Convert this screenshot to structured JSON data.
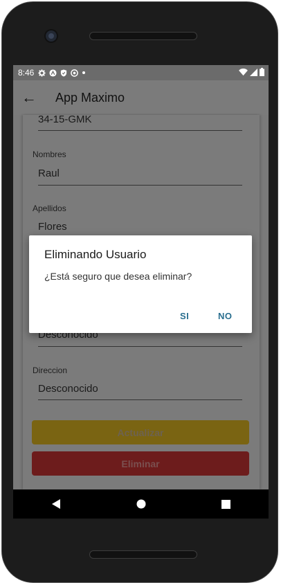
{
  "status_bar": {
    "time": "8:46"
  },
  "app_bar": {
    "back_glyph": "←",
    "title": "App Maximo"
  },
  "form": {
    "fields": [
      {
        "label": "",
        "value": "34-15-GMK"
      },
      {
        "label": "Nombres",
        "value": "Raul"
      },
      {
        "label": "Apellidos",
        "value": "Flores"
      },
      {
        "label": "",
        "value": "Desconocido"
      },
      {
        "label": "Direccion",
        "value": "Desconocido"
      }
    ],
    "update_label": "Actualizar",
    "delete_label": "Eliminar"
  },
  "dialog": {
    "title": "Eliminando Usuario",
    "message": "¿Está seguro que desea eliminar?",
    "yes_label": "SI",
    "no_label": "NO"
  },
  "colors": {
    "update_button": "#7a6412",
    "delete_button": "#6d1c1c",
    "dialog_button_text": "#2a6f8f"
  }
}
